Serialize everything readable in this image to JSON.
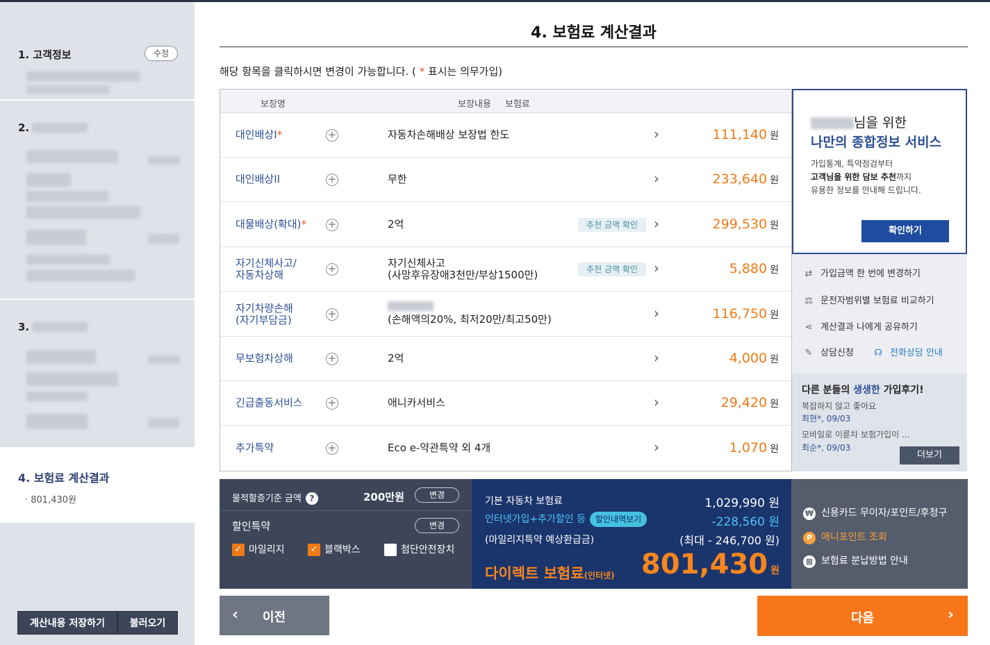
{
  "sidebar": {
    "sec1_title": "1. 고객정보",
    "sec1_edit": "수정",
    "sec2_title": "2.",
    "sec3_title": "3.",
    "active_title": "4. 보험료 계산결과",
    "active_value": "· 801,430원",
    "save_btn": "계산내용 저장하기",
    "load_btn": "불러오기"
  },
  "header": {
    "title": "4. 보험료 계산결과",
    "notice_pre": "해당 항목을 클릭하시면 변경이 가능합니다. ( ",
    "notice_star": "*",
    "notice_post": " 표시는 의무가입)"
  },
  "table": {
    "col_name": "보장명",
    "col_content": "보장내용",
    "col_premium": "보험료",
    "rec_label": "추천 금액 확인",
    "won": "원",
    "rows": [
      {
        "name": "대인배상I",
        "req": "*",
        "content": "자동차손해배상 보장법 한도",
        "content2": "",
        "premium": "111,140",
        "rec": false
      },
      {
        "name": "대인배상II",
        "req": "",
        "content": "무한",
        "content2": "",
        "premium": "233,640",
        "rec": false
      },
      {
        "name": "대물배상(확대)",
        "req": "*",
        "content": "2억",
        "content2": "",
        "premium": "299,530",
        "rec": true
      },
      {
        "name": "자기신체사고/",
        "name2": "자동차상해",
        "req": "",
        "content": "자기신체사고",
        "content2": "(사망후유장애3천만/부상1500만)",
        "premium": "5,880",
        "rec": true
      },
      {
        "name": "자기차량손해",
        "name2": "(자기부담금)",
        "req": "",
        "content": "",
        "content2": "(손해액의20%, 최저20만/최고50만)",
        "premium": "116,750",
        "rec": false
      },
      {
        "name": "무보험차상해",
        "req": "",
        "content": "2억",
        "content2": "",
        "premium": "4,000",
        "rec": false
      },
      {
        "name": "긴급출동서비스",
        "req": "",
        "content": "애니카서비스",
        "content2": "",
        "premium": "29,420",
        "rec": false
      },
      {
        "name": "추가특약",
        "req": "",
        "content": "Eco e-약관특약 외 4개",
        "content2": "",
        "premium": "1,070",
        "rec": false
      }
    ]
  },
  "promo": {
    "line1_suffix": "님을 위한",
    "line2": "나만의 종합정보 서비스",
    "desc1": "가입통계, 특약점검부터",
    "desc2_bold": "고객님을 위한 담보 추천",
    "desc2_rest": "까지",
    "desc3": "유용한 정보를 안내해 드립니다.",
    "btn": "확인하기"
  },
  "actions": {
    "a1": "가입금액 한 번에 변경하기",
    "a2": "운전자범위별 보험료 비교하기",
    "a3": "계산결과 나에게 공유하기",
    "a4": "상담신청",
    "a5": "전화상담 안내"
  },
  "reviews": {
    "head_pre": "다른 분들의 ",
    "head_hl": "생생한",
    "head_post": " 가입후기!",
    "r1": "복잡하지 않고 좋아요",
    "n1": "최현*, 09/03",
    "r2": "모바일로 이륜차 보험가입이 ...",
    "n2": "최순*, 09/03",
    "more": "더보기"
  },
  "options": {
    "mileage_label": "물적할증기준 금액",
    "mileage_value": "200만원",
    "change": "변경",
    "discount_label": "할인특약",
    "cb1": "마일리지",
    "cb2": "블랙박스",
    "cb3": "첨단안전장치"
  },
  "summary": {
    "base_label": "기본 자동차 보험료",
    "base_value": "1,029,990 원",
    "disc_label": "인터넷가입+추가할인 등",
    "disc_badge": "할인내역보기",
    "disc_value": "-228,560 원",
    "refund_label": "(마일리지특약 예상환급금)",
    "refund_value": "(최대 - 246,700 원)",
    "direct_label": "다이렉트 보험료",
    "direct_sub": "(인터넷)",
    "total": "801,430",
    "won": "원"
  },
  "payment": {
    "p1": "신용카드 무이자/포인트/후청구",
    "p2": "애니포인트 조회",
    "p3": "보험료 분납방법 안내"
  },
  "nav": {
    "prev": "이전",
    "next": "다음"
  }
}
